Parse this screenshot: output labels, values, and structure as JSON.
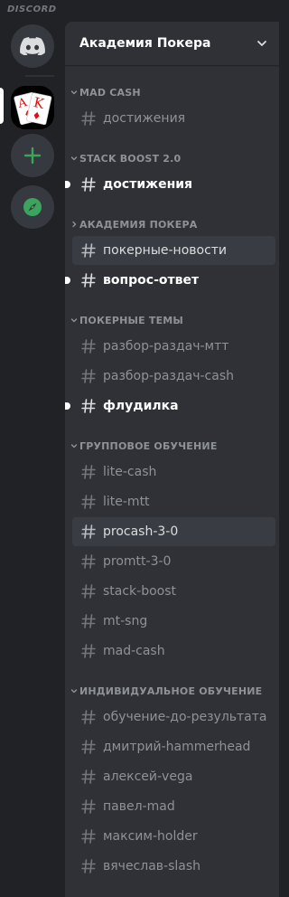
{
  "app": {
    "wordmark": "DISCORD"
  },
  "guild": {
    "name": "Академия Покера",
    "icon_label": "A K"
  },
  "colors": {
    "add_green": "#3ba55d",
    "explore_green": "#3ba55d",
    "rail_bg": "#202225",
    "panel_bg": "#2f3136"
  },
  "categories": [
    {
      "label": "MAD CASH",
      "expanded": true,
      "channels": [
        {
          "name": "достижения",
          "state": "normal"
        }
      ]
    },
    {
      "label": "STACK BOOST 2.0",
      "expanded": true,
      "channels": [
        {
          "name": "достижения",
          "state": "unread"
        }
      ]
    },
    {
      "label": "АКАДЕМИЯ ПОКЕРА",
      "expanded": false,
      "channels": [
        {
          "name": "покерные-новости",
          "state": "active"
        },
        {
          "name": "вопрос-ответ",
          "state": "unread"
        }
      ]
    },
    {
      "label": "ПОКЕРНЫЕ ТЕМЫ",
      "expanded": true,
      "channels": [
        {
          "name": "разбор-раздач-мтт",
          "state": "normal"
        },
        {
          "name": "разбор-раздач-cash",
          "state": "normal"
        },
        {
          "name": "флудилка",
          "state": "unread"
        }
      ]
    },
    {
      "label": "ГРУППОВОЕ ОБУЧЕНИЕ",
      "expanded": true,
      "channels": [
        {
          "name": "lite-cash",
          "state": "normal"
        },
        {
          "name": "lite-mtt",
          "state": "normal"
        },
        {
          "name": "procash-3-0",
          "state": "active"
        },
        {
          "name": "promtt-3-0",
          "state": "normal"
        },
        {
          "name": "stack-boost",
          "state": "normal"
        },
        {
          "name": "mt-sng",
          "state": "normal"
        },
        {
          "name": "mad-cash",
          "state": "normal"
        }
      ]
    },
    {
      "label": "ИНДИВИДУАЛЬНОЕ ОБУЧЕНИЕ",
      "expanded": true,
      "channels": [
        {
          "name": "обучение-до-результата",
          "state": "normal"
        },
        {
          "name": "дмитрий-hammerhead",
          "state": "normal"
        },
        {
          "name": "алексей-vega",
          "state": "normal"
        },
        {
          "name": "павел-mad",
          "state": "normal"
        },
        {
          "name": "максим-holder",
          "state": "normal"
        },
        {
          "name": "вячеслав-slash",
          "state": "normal"
        }
      ]
    }
  ]
}
